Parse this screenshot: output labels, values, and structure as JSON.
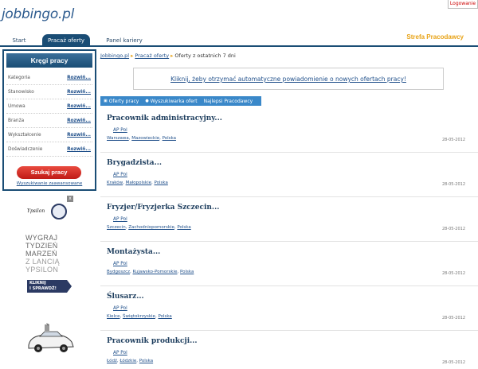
{
  "header": {
    "logo": "jobbingo.pl",
    "login_label": "Logowanie",
    "strefa_label": "Strefa Pracodawcy"
  },
  "nav": {
    "tabs": [
      {
        "label": "Start"
      },
      {
        "label": "Pracaż oferty"
      },
      {
        "label": "Panel kariery"
      }
    ]
  },
  "sidebar": {
    "title": "Kręgi pracy",
    "filters": [
      {
        "label": "Kategoria",
        "action": "Rozwiń..."
      },
      {
        "label": "Stanowisko",
        "action": "Rozwiń..."
      },
      {
        "label": "Umowa",
        "action": "Rozwiń..."
      },
      {
        "label": "Branża",
        "action": "Rozwiń..."
      },
      {
        "label": "Wykształcenie",
        "action": "Rozwiń..."
      },
      {
        "label": "Doświadczenie",
        "action": "Rozwiń..."
      }
    ],
    "search_button": "Szukaj pracy",
    "advanced_link": "Wyszukiwanie zaawansowane"
  },
  "ad": {
    "close": "x",
    "brand": "Ypsilon",
    "slogan_lines": [
      "WYGRAJ",
      "TYDZIEŃ",
      "MARZEŃ",
      "Z LANCIĄ",
      "YPSILON"
    ],
    "cta_lines": [
      "KLIKNIJ",
      "I SPRAWDŹ!"
    ]
  },
  "breadcrumb": {
    "items": [
      "Jobbingo.pl",
      "Pracaż oferty",
      "Oferty z ostatnich 7 dni"
    ]
  },
  "notification": "Kliknij, żeby otrzymać automatyczne powiadomienie o nowych ofertach pracy!",
  "toolbar": {
    "items": [
      "Oferty pracy",
      "Wyszukiwarka ofert",
      "Najlepsi Pracodawcy"
    ]
  },
  "offers": [
    {
      "title": "Pracownik administracyjny...",
      "company": "AP Pol",
      "locations": [
        "Warszawa",
        "Mazowieckie",
        "Polska"
      ],
      "date": "28-05-2012"
    },
    {
      "title": "Brygadzista...",
      "company": "AP Pol",
      "locations": [
        "Kraków",
        "Małopolskie",
        "Polska"
      ],
      "date": "28-05-2012"
    },
    {
      "title": "Fryzjer/Fryzjerka Szczecin...",
      "company": "AP Pol",
      "locations": [
        "Szczecin",
        "Zachodniopomorskie",
        "Polska"
      ],
      "date": "28-05-2012"
    },
    {
      "title": "Montażysta...",
      "company": "AP Pol",
      "locations": [
        "Bydgoszcz",
        "Kujawsko-Pomorskie",
        "Polska"
      ],
      "date": "28-05-2012"
    },
    {
      "title": "Ślusarz...",
      "company": "AP Pol",
      "locations": [
        "Kielce",
        "Świętokrzyskie",
        "Polska"
      ],
      "date": "28-05-2012"
    },
    {
      "title": "Pracownik produkcji...",
      "company": "AP Pol",
      "locations": [
        "Łódź",
        "Łódzkie",
        "Polska"
      ],
      "date": "28-05-2012"
    }
  ],
  "colors": {
    "primary_navy": "#1a4d75",
    "accent_orange": "#e8a317",
    "search_red": "#c01b16",
    "toolbar_blue": "#3a88c9"
  }
}
